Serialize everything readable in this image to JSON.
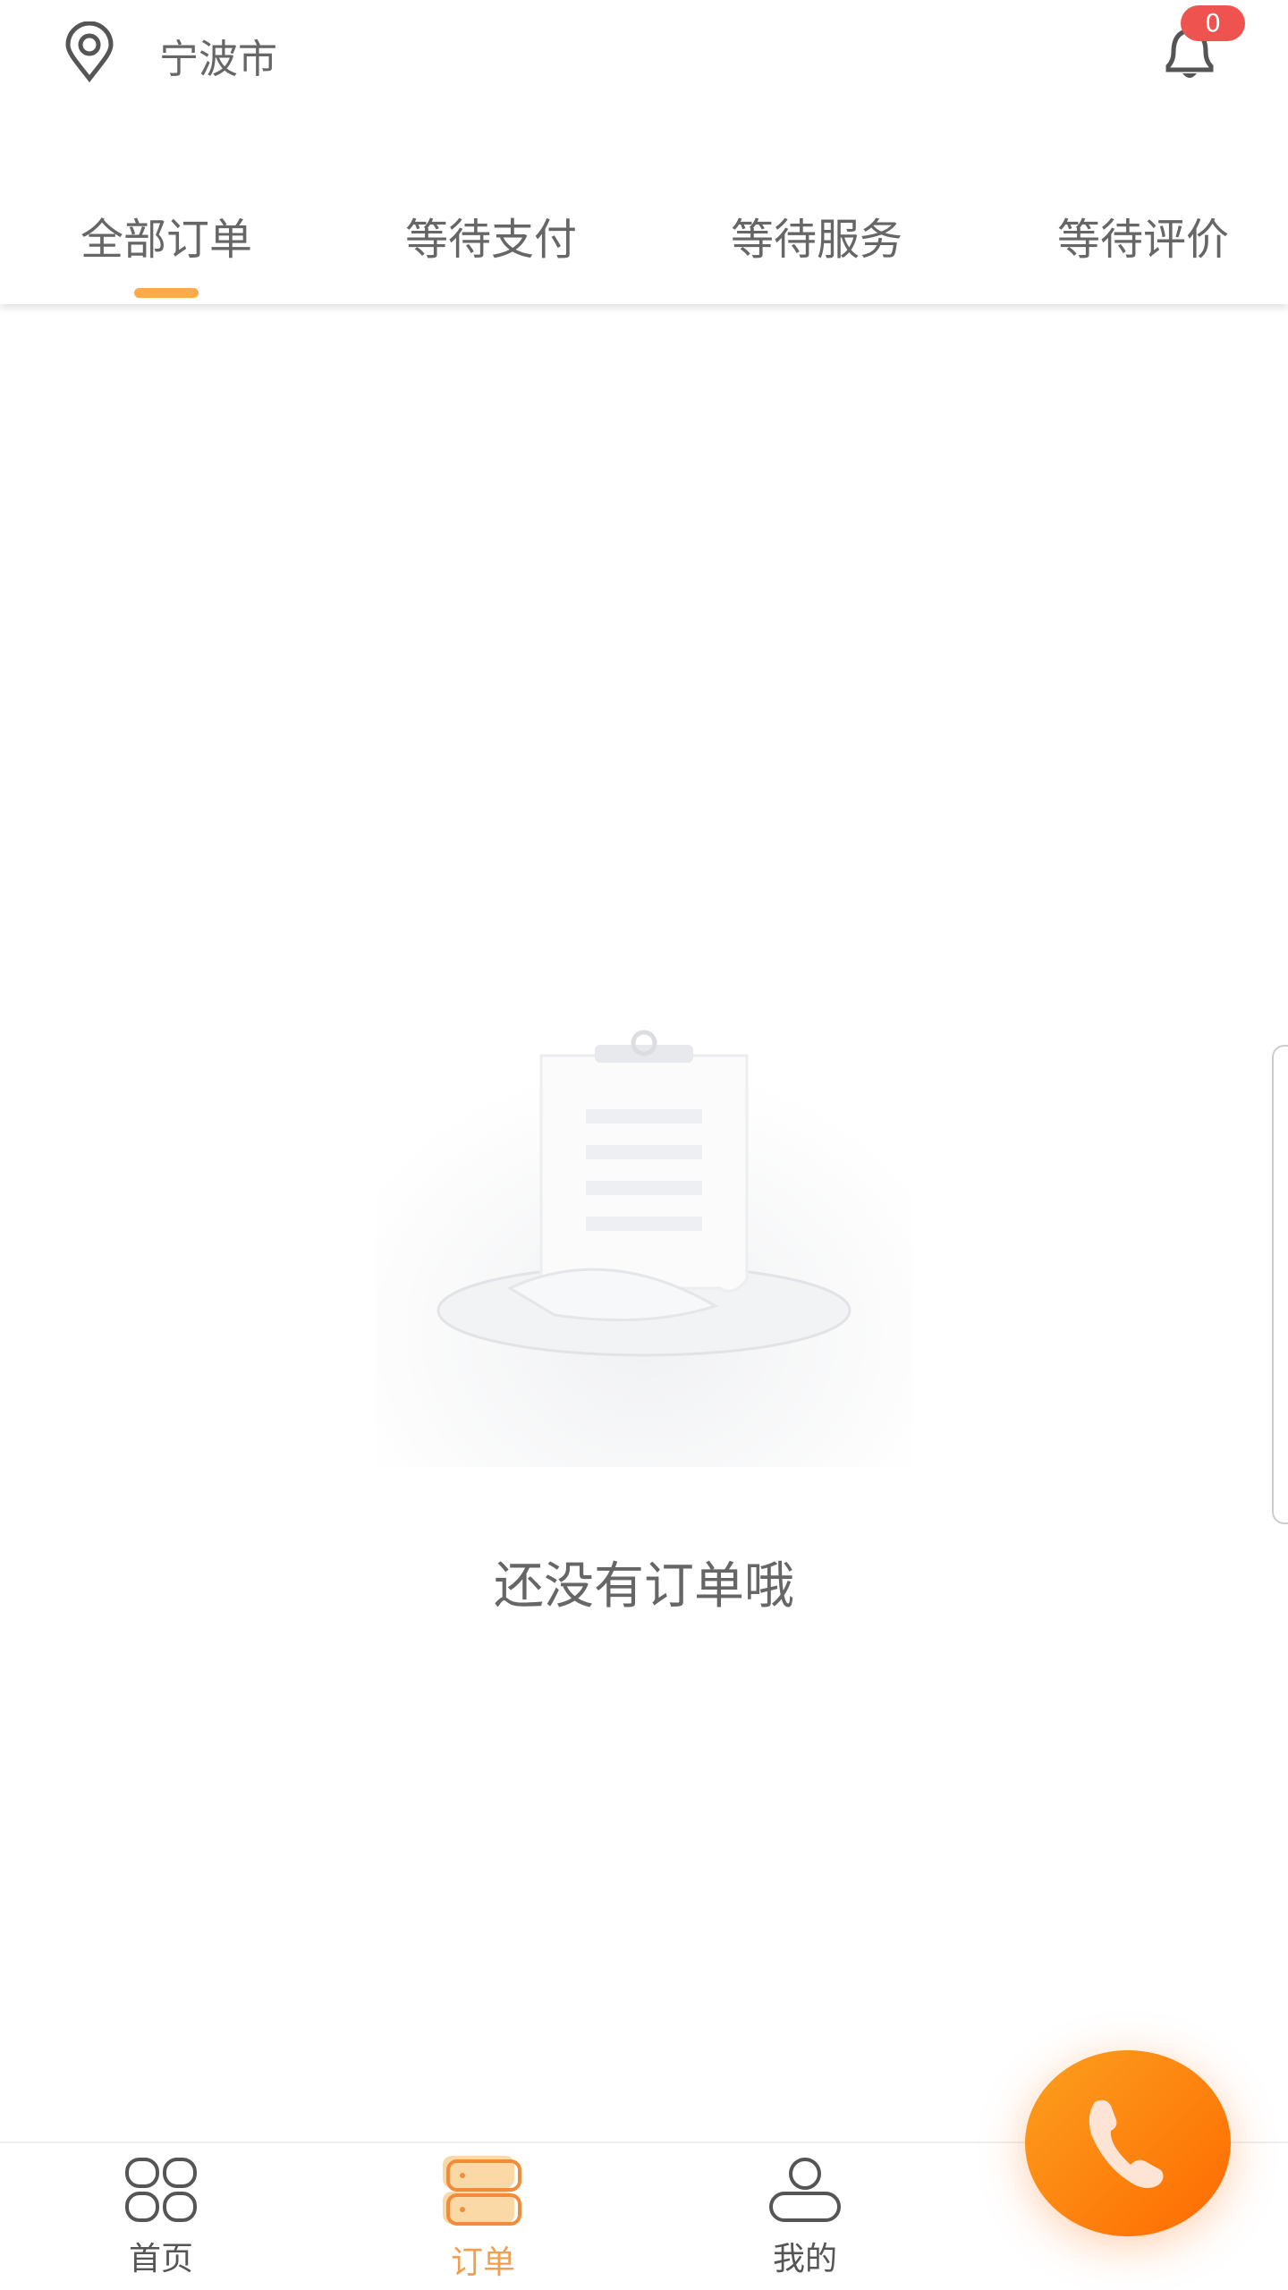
{
  "header": {
    "city": "宁波市",
    "location_icon": "map-pin-icon",
    "bell_icon": "bell-icon",
    "notification_count": "0"
  },
  "tabs": [
    {
      "label": "全部订单",
      "active": true
    },
    {
      "label": "等待支付",
      "active": false
    },
    {
      "label": "等待服务",
      "active": false
    },
    {
      "label": "等待评价",
      "active": false
    }
  ],
  "empty_state": {
    "message": "还没有订单哦",
    "illustration": "clipboard-on-plate"
  },
  "fab": {
    "icon": "phone-icon"
  },
  "bottom_nav": [
    {
      "label": "首页",
      "icon": "grid-icon",
      "active": false
    },
    {
      "label": "订单",
      "icon": "orders-icon",
      "active": true
    },
    {
      "label": "我的",
      "icon": "user-icon",
      "active": false
    }
  ],
  "colors": {
    "accent": "#ffa94d",
    "badge": "#ef5350",
    "fab_start": "#fca01f",
    "fab_end": "#fe6a00",
    "active_nav": "#f0a050"
  }
}
